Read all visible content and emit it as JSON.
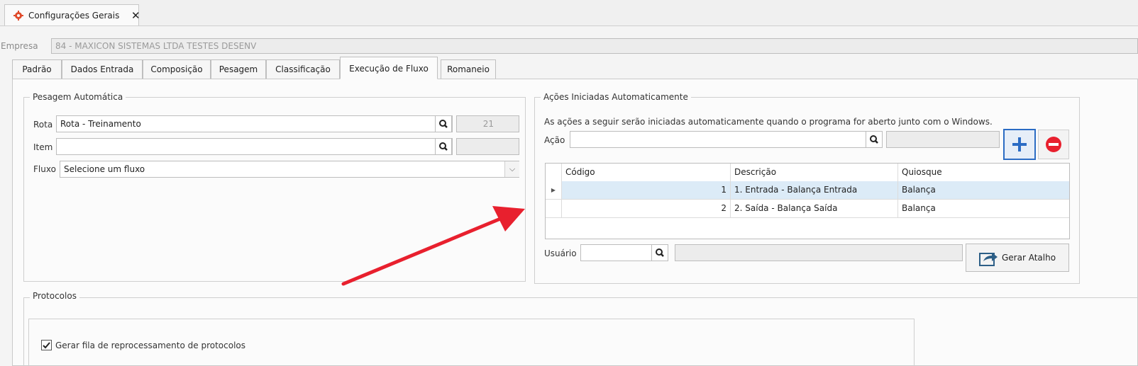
{
  "window": {
    "tab_title": "Configurações Gerais",
    "close_glyph": "✕"
  },
  "empresa": {
    "label": "Empresa",
    "value": "84 - MAXICON SISTEMAS LTDA TESTES DESENV"
  },
  "tabs": [
    {
      "label": "Padrão"
    },
    {
      "label": "Dados Entrada"
    },
    {
      "label": "Composição"
    },
    {
      "label": "Pesagem"
    },
    {
      "label": "Classificação"
    },
    {
      "label": "Execução de Fluxo",
      "active": true
    },
    {
      "label": "Romaneio"
    }
  ],
  "pesagem": {
    "title": "Pesagem Automática",
    "rota": {
      "label": "Rota",
      "value": "Rota - Treinamento",
      "code": "21"
    },
    "item": {
      "label": "Item",
      "value": "",
      "code": ""
    },
    "fluxo": {
      "label": "Fluxo",
      "value": "Selecione um fluxo"
    }
  },
  "acoes": {
    "title": "Ações Iniciadas Automaticamente",
    "description": "As ações a seguir serão iniciadas automaticamente quando o programa for aberto junto com o Windows.",
    "acao": {
      "label": "Ação",
      "value": ""
    },
    "grid": {
      "columns": [
        "Código",
        "Descrição",
        "Quiosque"
      ],
      "rows": [
        {
          "codigo": "1",
          "descricao": "1. Entrada - Balança Entrada",
          "quiosque": "Balança"
        },
        {
          "codigo": "2",
          "descricao": "2. Saída - Balança Saída",
          "quiosque": "Balança"
        }
      ]
    },
    "usuario": {
      "label": "Usuário",
      "value": ""
    },
    "gerar_atalho": "Gerar Atalho"
  },
  "protocolos": {
    "title": "Protocolos",
    "checkbox": {
      "label": "Gerar fila de reprocessamento de protocolos",
      "checked": true
    }
  },
  "colors": {
    "accent": "#2b6cc4",
    "remove": "#e8202e",
    "arrow": "#e8202e",
    "selected_row": "#dcebf7"
  },
  "icons": {
    "settings": "gear-icon",
    "search": "search-icon",
    "add": "plus-icon",
    "remove": "minus-circle-icon",
    "shortcut": "share-arrow-icon"
  }
}
